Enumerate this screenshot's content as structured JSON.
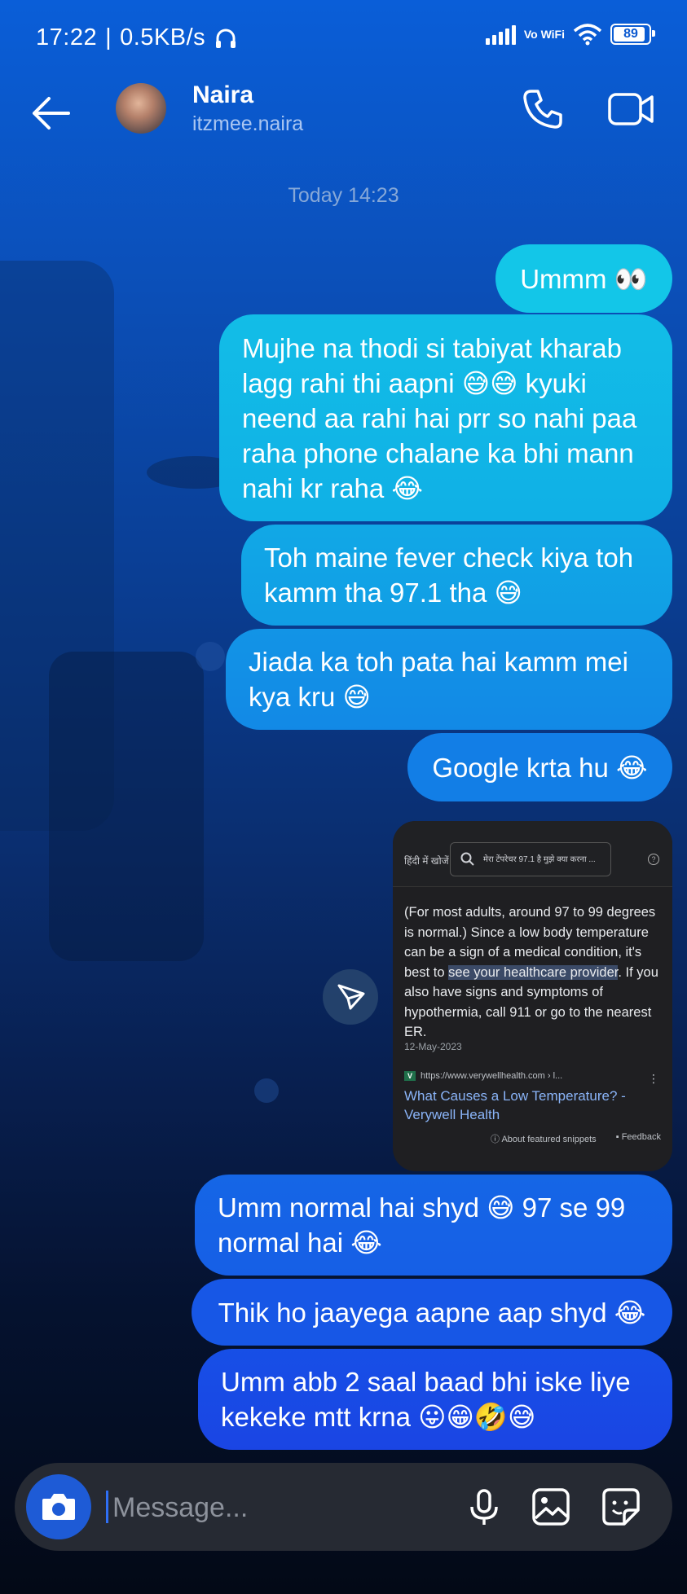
{
  "status_bar": {
    "time": "17:22",
    "network_speed": "0.5KB/s",
    "vowifi": "Vo WiFi",
    "battery": "89"
  },
  "header": {
    "name": "Naira",
    "username": "itzmee.naira"
  },
  "chat": {
    "timestamp": "Today 14:23",
    "messages": [
      "Ummm 👀",
      "Mujhe na thodi si tabiyat kharab lagg rahi thi aapni 😅😅 kyuki neend aa rahi hai prr so nahi paa raha phone chalane ka bhi mann nahi kr raha 😂",
      "Toh maine fever check kiya toh kamm tha 97.1 tha 😅",
      "Jiada ka toh pata hai kamm mei kya kru 😅",
      "Google krta hu 😂",
      "Umm normal hai shyd 😅 97 se 99 normal hai 😂",
      "Thik ho jaayega aapne aap shyd 😂",
      "Umm abb 2 saal baad bhi iske liye kekeke mtt krna 😛😁🤣😅"
    ],
    "screenshot": {
      "hindi_search_label": "हिंदी में खोजें",
      "search_query": "मेरा टेंपरेचर 97.1 है मुझे क्या करना ...",
      "snippet_before": "(For most adults, around 97 to 99 degrees is normal.) Since a low body temperature can be a sign of a medical condition, it's best to ",
      "snippet_highlight": "see your healthcare provider",
      "snippet_after": ". If you also have signs and symptoms of hypothermia, call 911 or go to the nearest ER.",
      "date": "12-May-2023",
      "source_url": "https://www.verywellhealth.com › l...",
      "link_title": "What Causes a Low Temperature? - Verywell Health",
      "about_snippets": "About featured snippets",
      "feedback": "Feedback"
    }
  },
  "composer": {
    "placeholder": "Message..."
  },
  "colors": {
    "bubble_cyan": "#13c6e8",
    "bubble_blue": "#1d4fe6",
    "camera_button": "#1e5bd6",
    "link": "#8ab4f8"
  }
}
